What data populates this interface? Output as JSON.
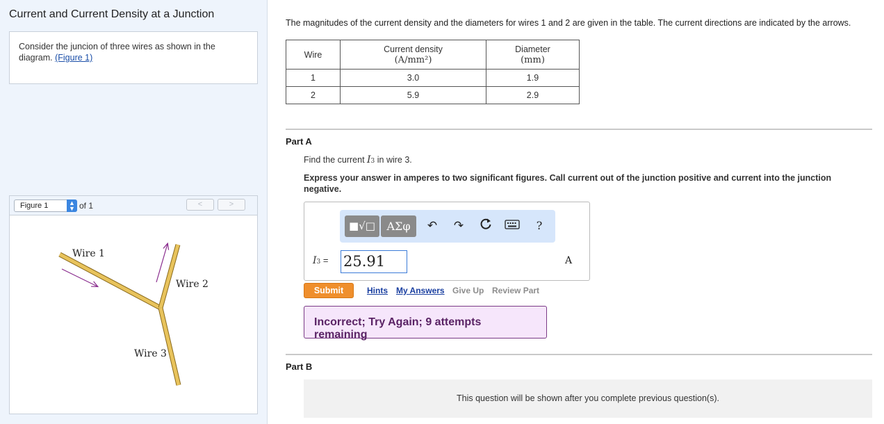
{
  "left": {
    "title": "Current and Current Density at a Junction",
    "intro_text": "Consider the juncion of three wires as shown in the diagram. ",
    "figure_link": "(Figure 1)",
    "figure_select_value": "Figure 1",
    "figure_of": "of 1",
    "prev_label": "<",
    "next_label": ">",
    "diagram": {
      "wire1_label": "Wire 1",
      "wire2_label": "Wire 2",
      "wire3_label": "Wire 3",
      "wire_color": "#e8c35c",
      "arrow_color": "#8a2d8e"
    }
  },
  "main": {
    "intro": "The magnitudes of the current density and the diameters for wires 1 and 2 are given in the table. The current directions are indicated by the arrows.",
    "table": {
      "headers": {
        "wire": "Wire",
        "density": "Current density",
        "density_unit": "(A/mm²)",
        "diameter": "Diameter",
        "diameter_unit": "(mm)"
      },
      "rows": [
        {
          "wire": "1",
          "density": "3.0",
          "diameter": "1.9"
        },
        {
          "wire": "2",
          "density": "5.9",
          "diameter": "2.9"
        }
      ]
    },
    "part_a": {
      "label": "Part A",
      "question_prefix": "Find the current ",
      "question_var": "I",
      "question_sub": "3",
      "question_suffix": " in wire 3.",
      "instructions": "Express your answer in amperes to two significant figures. Call current out of the junction positive and current into the junction negative.",
      "toolbar": {
        "template_label": "■√□",
        "greek_label": "ΑΣφ"
      },
      "eq_var": "I",
      "eq_sub": "3",
      "eq_sign": " =",
      "answer_value": "25.91",
      "unit": "A",
      "submit_label": "Submit",
      "links": {
        "hints": "Hints",
        "my_answers": "My Answers",
        "give_up": "Give Up",
        "review_part": "Review Part"
      },
      "feedback": "Incorrect; Try Again; 9 attempts remaining"
    },
    "part_b": {
      "label": "Part B",
      "notice": "This question will be shown after you complete previous question(s)."
    }
  },
  "colors": {
    "submit": "#ef8f2d",
    "feedback_bg": "#f6e6fb",
    "feedback_border": "#7a3a86",
    "link": "#1a3fa0",
    "toolbar_bg": "#d6e6fb"
  }
}
